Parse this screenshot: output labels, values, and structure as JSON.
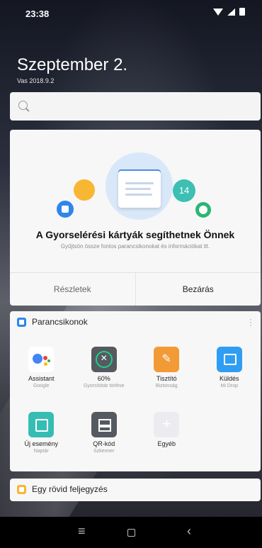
{
  "status_bar": {
    "time": "23:38"
  },
  "header": {
    "date": "Szeptember 2.",
    "subdate": "Vas 2018.9.2"
  },
  "search": {
    "placeholder": ""
  },
  "tips_card": {
    "badge_number": "14",
    "title": "A Gyorselérési kártyák segíthetnek Önnek",
    "description": "Gyűjtsön össze fontos parancsikonokat és információkat itt.",
    "details_button": "Részletek",
    "close_button": "Bezárás"
  },
  "shortcuts_card": {
    "title": "Parancsikonok",
    "items": [
      {
        "label": "Assistant",
        "sublabel": "Google",
        "icon": "google-assistant-icon"
      },
      {
        "label": "60%",
        "sublabel": "Gyorsítótár törlése",
        "icon": "cache-clean-icon"
      },
      {
        "label": "Tisztító",
        "sublabel": "Biztonság",
        "icon": "broom-icon"
      },
      {
        "label": "Küldés",
        "sublabel": "Mi Drop",
        "icon": "mi-drop-icon"
      },
      {
        "label": "Új esemény",
        "sublabel": "Naptár",
        "icon": "calendar-icon"
      },
      {
        "label": "QR-kód",
        "sublabel": "Szkenner",
        "icon": "qr-scanner-icon"
      },
      {
        "label": "Egyéb",
        "sublabel": "",
        "icon": "plus-icon"
      }
    ]
  },
  "note_card": {
    "title": "Egy rövid feljegyzés"
  },
  "colors": {
    "accent_blue": "#2f86e8",
    "yellow": "#f7b733",
    "teal": "#3dbfb3",
    "green": "#2bb673",
    "orange": "#f29a36"
  }
}
